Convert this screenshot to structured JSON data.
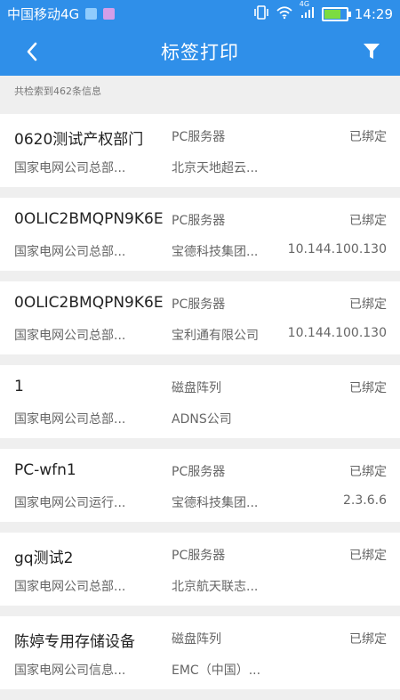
{
  "status_bar": {
    "carrier": "中国移动4G",
    "time": "14:29",
    "net": "4G"
  },
  "header": {
    "title": "标签打印"
  },
  "summary": "共检索到462条信息",
  "items": [
    {
      "name": "0620测试产权部门",
      "type": "PC服务器",
      "status": "已绑定",
      "company": "国家电网公司总部...",
      "vendor": "北京天地超云...",
      "ip": ""
    },
    {
      "name": "0OLIC2BMQPN9K6E",
      "type": "PC服务器",
      "status": "已绑定",
      "company": "国家电网公司总部...",
      "vendor": "宝德科技集团...",
      "ip": "10.144.100.130"
    },
    {
      "name": "0OLIC2BMQPN9K6E",
      "type": "PC服务器",
      "status": "已绑定",
      "company": "国家电网公司总部...",
      "vendor": "宝利通有限公司",
      "ip": "10.144.100.130"
    },
    {
      "name": "1",
      "type": "磁盘阵列",
      "status": "已绑定",
      "company": "国家电网公司总部...",
      "vendor": "ADNS公司",
      "ip": ""
    },
    {
      "name": "PC-wfn1",
      "type": "PC服务器",
      "status": "已绑定",
      "company": "国家电网公司运行...",
      "vendor": "宝德科技集团...",
      "ip": "2.3.6.6"
    },
    {
      "name": "gq测试2",
      "type": "PC服务器",
      "status": "已绑定",
      "company": "国家电网公司总部...",
      "vendor": "北京航天联志...",
      "ip": ""
    },
    {
      "name": "陈婷专用存储设备",
      "type": "磁盘阵列",
      "status": "已绑定",
      "company": "国家电网公司信息...",
      "vendor": "EMC（中国）...",
      "ip": ""
    }
  ],
  "colors": {
    "accent": "#2f8fe9"
  }
}
